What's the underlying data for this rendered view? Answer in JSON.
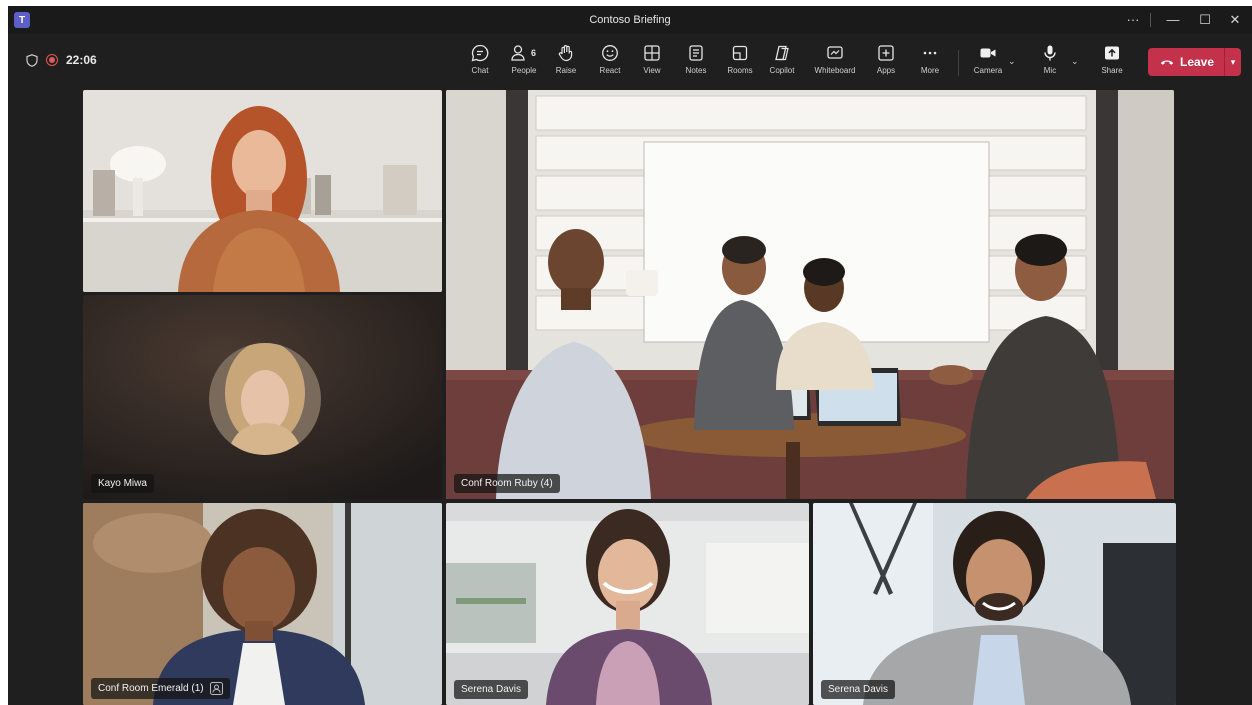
{
  "window": {
    "title": "Contoso Briefing",
    "more_label": "···",
    "minimize_label": "—",
    "maximize_label": "☐",
    "close_label": "✕"
  },
  "status": {
    "timer": "22:06"
  },
  "toolbar": {
    "chat": "Chat",
    "people": "People",
    "people_count": "6",
    "raise": "Raise",
    "react": "React",
    "view": "View",
    "notes": "Notes",
    "rooms": "Rooms",
    "copilot": "Copilot",
    "whiteboard": "Whiteboard",
    "apps": "Apps",
    "more": "More",
    "camera": "Camera",
    "mic": "Mic",
    "share": "Share",
    "leave": "Leave"
  },
  "participants": {
    "kayo": "Kayo Miwa",
    "ruby": "Conf Room Ruby (4)",
    "emerald": "Conf Room Emerald (1)",
    "serena1": "Serena Davis",
    "serena2": "Serena Davis"
  },
  "colors": {
    "leave": "#c4314b",
    "recording": "#e05a5a",
    "teams_brand": "#5b5fc7"
  }
}
